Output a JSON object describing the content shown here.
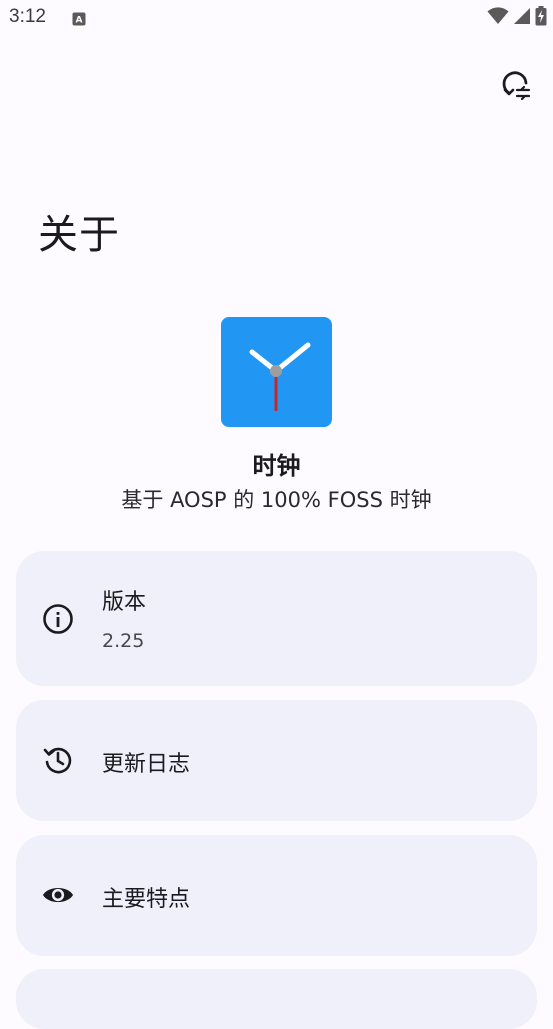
{
  "status_bar": {
    "time": "3:12",
    "icons": [
      "keyboard-a-icon",
      "wifi-icon",
      "signal-icon",
      "battery-charging-icon"
    ]
  },
  "toolbar": {
    "action_icon": "restore-settings-icon"
  },
  "page": {
    "title": "关于"
  },
  "app": {
    "name": "时钟",
    "description": "基于 AOSP 的 100% FOSS 时钟",
    "icon_color": "#2196f3"
  },
  "cards": [
    {
      "icon": "info-icon",
      "title": "版本",
      "subtitle": "2.25"
    },
    {
      "icon": "history-icon",
      "title": "更新日志"
    },
    {
      "icon": "eye-icon",
      "title": "主要特点"
    }
  ],
  "colors": {
    "background": "#fdfbff",
    "card": "#eff0f9",
    "accent": "#2196f3"
  }
}
